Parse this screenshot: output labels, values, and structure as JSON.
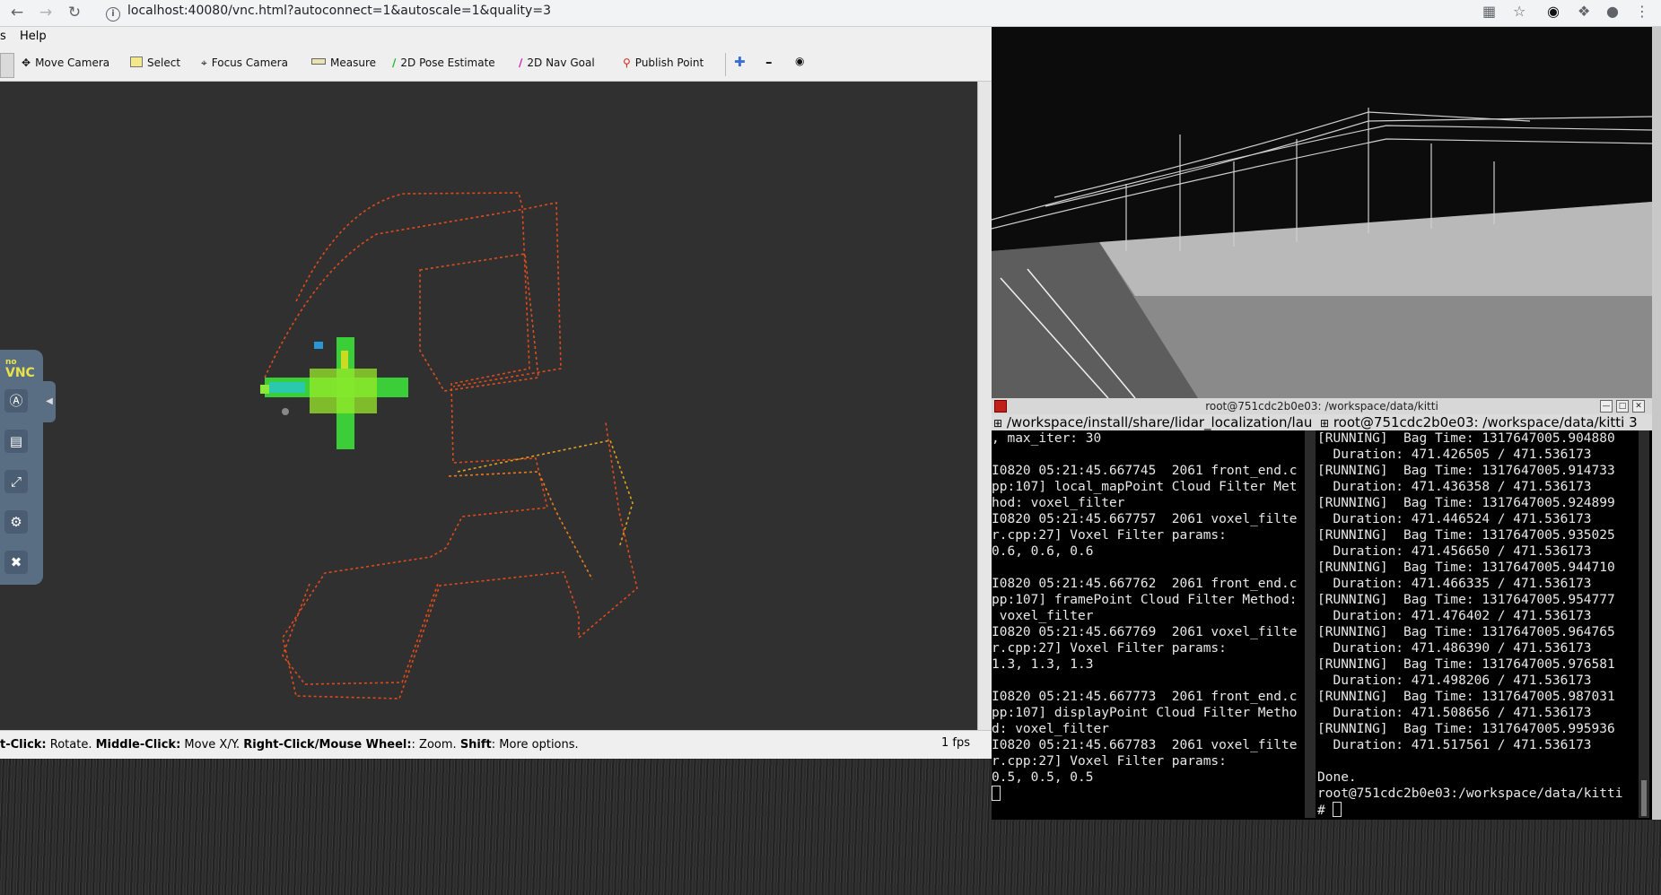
{
  "browser": {
    "url": "localhost:40080/vnc.html?autoconnect=1&autoscale=1&quality=3"
  },
  "menubar": {
    "items": [
      "s",
      "Help"
    ]
  },
  "toolbar": {
    "tools": [
      {
        "label": "Move Camera",
        "icon": "move-camera-icon"
      },
      {
        "label": "Select",
        "icon": "select-icon"
      },
      {
        "label": "Focus Camera",
        "icon": "focus-camera-icon"
      },
      {
        "label": "Measure",
        "icon": "measure-icon"
      },
      {
        "label": "2D Pose Estimate",
        "icon": "pose-estimate-icon"
      },
      {
        "label": "2D Nav Goal",
        "icon": "nav-goal-icon"
      },
      {
        "label": "Publish Point",
        "icon": "publish-point-icon"
      }
    ]
  },
  "status": {
    "parts": [
      {
        "bold": "t-Click:",
        "text": " Rotate. "
      },
      {
        "bold": "Middle-Click:",
        "text": " Move X/Y. "
      },
      {
        "bold": "Right-Click/Mouse Wheel:",
        "text": ": Zoom. "
      },
      {
        "bold": "Shift",
        "text": ": More options."
      }
    ],
    "fps": "1 fps"
  },
  "terminal": {
    "title": "root@751cdc2b0e03: /workspace/data/kitti",
    "tab_left": "/workspace/install/share/lidar_localization/lau",
    "tab_right": "root@751cdc2b0e03: /workspace/data/kitti 3",
    "left_lines": [
      ", max_iter: 30",
      "",
      "I0820 05:21:45.667745  2061 front_end.c",
      "pp:107] local_mapPoint Cloud Filter Met",
      "hod: voxel_filter",
      "I0820 05:21:45.667757  2061 voxel_filte",
      "r.cpp:27] Voxel Filter params:",
      "0.6, 0.6, 0.6",
      "",
      "I0820 05:21:45.667762  2061 front_end.c",
      "pp:107] framePoint Cloud Filter Method:",
      " voxel_filter",
      "I0820 05:21:45.667769  2061 voxel_filte",
      "r.cpp:27] Voxel Filter params:",
      "1.3, 1.3, 1.3",
      "",
      "I0820 05:21:45.667773  2061 front_end.c",
      "pp:107] displayPoint Cloud Filter Metho",
      "d: voxel_filter",
      "I0820 05:21:45.667783  2061 voxel_filte",
      "r.cpp:27] Voxel Filter params:",
      "0.5, 0.5, 0.5"
    ],
    "right_lines": [
      "[RUNNING]  Bag Time: 1317647005.904880",
      "  Duration: 471.426505 / 471.536173",
      "[RUNNING]  Bag Time: 1317647005.914733",
      "  Duration: 471.436358 / 471.536173",
      "[RUNNING]  Bag Time: 1317647005.924899",
      "  Duration: 471.446524 / 471.536173",
      "[RUNNING]  Bag Time: 1317647005.935025",
      "  Duration: 471.456650 / 471.536173",
      "[RUNNING]  Bag Time: 1317647005.944710",
      "  Duration: 471.466335 / 471.536173",
      "[RUNNING]  Bag Time: 1317647005.954777",
      "  Duration: 471.476402 / 471.536173",
      "[RUNNING]  Bag Time: 1317647005.964765",
      "  Duration: 471.486390 / 471.536173",
      "[RUNNING]  Bag Time: 1317647005.976581",
      "  Duration: 471.498206 / 471.536173",
      "[RUNNING]  Bag Time: 1317647005.987031",
      "  Duration: 471.508656 / 471.536173",
      "[RUNNING]  Bag Time: 1317647005.995936",
      "  Duration: 471.517561 / 471.536173",
      "",
      "Done.",
      "root@751cdc2b0e03:/workspace/data/kitti",
      "# "
    ]
  },
  "novnc": {
    "logo": "VNC",
    "logo_small": "no"
  },
  "colors": {
    "viewport": "#303030",
    "trajectory": "#e04a1a",
    "pointcloud": "#3ee03a"
  }
}
